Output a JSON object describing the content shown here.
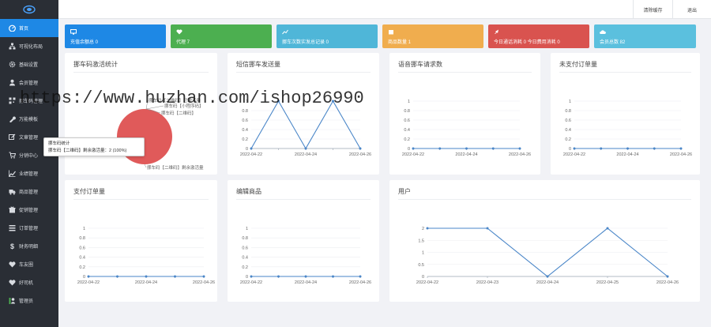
{
  "sidebar": {
    "items": [
      {
        "label": "首页",
        "icon": "dashboard-icon",
        "active": true
      },
      {
        "label": "可视化布局",
        "icon": "sitemap-icon"
      },
      {
        "label": "基础设置",
        "icon": "gear-icon"
      },
      {
        "label": "会员管理",
        "icon": "user-icon"
      },
      {
        "label": "挪车码管理",
        "icon": "qrcode-icon"
      },
      {
        "label": "万能模板",
        "icon": "wrench-icon"
      },
      {
        "label": "文章管理",
        "icon": "edit-icon"
      },
      {
        "label": "分销中心",
        "icon": "cart-icon"
      },
      {
        "label": "业绩管理",
        "icon": "chart-icon"
      },
      {
        "label": "商品管理",
        "icon": "truck-icon"
      },
      {
        "label": "促销管理",
        "icon": "gift-icon"
      },
      {
        "label": "订单管理",
        "icon": "list-icon"
      },
      {
        "label": "财务明细",
        "icon": "dollar-icon"
      },
      {
        "label": "车友圈",
        "icon": "heart-icon"
      },
      {
        "label": "好司机",
        "icon": "heart-icon"
      },
      {
        "label": "管理员",
        "icon": "admin-icon"
      }
    ]
  },
  "topbar": {
    "clear_cache": "清除缓存",
    "logout": "退出"
  },
  "stats": [
    {
      "label": "充值余额总 0",
      "color": "#1e88e5",
      "icon": "monitor-icon"
    },
    {
      "label": "代理 7",
      "color": "#4caf50",
      "icon": "heart-icon"
    },
    {
      "label": "挪车次数实发总记录 0",
      "color": "#4fb6d8",
      "icon": "line-chart-icon"
    },
    {
      "label": "商品数量 1",
      "color": "#f0ad4e",
      "icon": "cube-icon"
    },
    {
      "label": "今日通话消耗 0 今日费用消耗 0",
      "color": "#d9534f",
      "icon": "rocket-icon"
    },
    {
      "label": "会员总数 82",
      "color": "#5bc0de",
      "icon": "cloud-icon"
    }
  ],
  "cards": {
    "activation": {
      "title": "挪车码激活统计"
    },
    "sms": {
      "title": "短信挪车发送量"
    },
    "voice": {
      "title": "语音挪车请求数"
    },
    "unpaid": {
      "title": "未支付订单量"
    },
    "paid": {
      "title": "支付订单量"
    },
    "edit_goods": {
      "title": "编辑商品"
    },
    "users": {
      "title": "用户"
    }
  },
  "tooltip": {
    "line1": "挪车码统计",
    "line2": "挪车码【二维码】剩余激活量：2 (100%)"
  },
  "watermark": "https://www.huzhan.com/ishop26990",
  "chart_data": [
    {
      "type": "pie",
      "title": "挪车码激活统计",
      "labels": [
        "挪车码【二维码】已激活量",
        "挪车码【小程序码】",
        "挪车码【二维码】",
        "挪车码【二维码】剩余激活量"
      ],
      "values": [
        0,
        0,
        0,
        2
      ],
      "colors": [
        "#e05a5a"
      ]
    },
    {
      "type": "line",
      "title": "短信挪车发送量",
      "x": [
        "2022-04-22",
        "2022-04-23",
        "2022-04-24",
        "2022-04-25",
        "2022-04-26"
      ],
      "y": [
        0,
        1,
        0,
        1,
        0
      ],
      "yticks": [
        "0",
        "0.2",
        "0.4",
        "0.6",
        "0.8",
        "1"
      ],
      "xticks": [
        "2022-04-22",
        "2022-04-24",
        "2022-04-26"
      ],
      "ylim": [
        0,
        1
      ]
    },
    {
      "type": "line",
      "title": "语音挪车请求数",
      "x": [
        "2022-04-22",
        "2022-04-23",
        "2022-04-24",
        "2022-04-25",
        "2022-04-26"
      ],
      "y": [
        0,
        0,
        0,
        0,
        0
      ],
      "yticks": [
        "0",
        "0.2",
        "0.4",
        "0.6",
        "0.8",
        "1"
      ],
      "xticks": [
        "2022-04-22",
        "2022-04-24",
        "2022-04-26"
      ],
      "ylim": [
        0,
        1
      ]
    },
    {
      "type": "line",
      "title": "未支付订单量",
      "x": [
        "2022-04-22",
        "2022-04-23",
        "2022-04-24",
        "2022-04-25",
        "2022-04-26"
      ],
      "y": [
        0,
        0,
        0,
        0,
        0
      ],
      "yticks": [
        "0",
        "0.2",
        "0.4",
        "0.6",
        "0.8",
        "1"
      ],
      "xticks": [
        "2022-04-22",
        "2022-04-24",
        "2022-04-26"
      ],
      "ylim": [
        0,
        1
      ]
    },
    {
      "type": "line",
      "title": "支付订单量",
      "x": [
        "2022-04-22",
        "2022-04-23",
        "2022-04-24",
        "2022-04-25",
        "2022-04-26"
      ],
      "y": [
        0,
        0,
        0,
        0,
        0
      ],
      "yticks": [
        "0",
        "0.2",
        "0.4",
        "0.6",
        "0.8",
        "1"
      ],
      "xticks": [
        "2022-04-22",
        "2022-04-24",
        "2022-04-26"
      ],
      "ylim": [
        0,
        1
      ]
    },
    {
      "type": "line",
      "title": "编辑商品",
      "x": [
        "2022-04-22",
        "2022-04-23",
        "2022-04-24",
        "2022-04-25",
        "2022-04-26"
      ],
      "y": [
        0,
        0,
        0,
        0,
        0
      ],
      "yticks": [
        "0",
        "0.2",
        "0.4",
        "0.6",
        "0.8",
        "1"
      ],
      "xticks": [
        "2022-04-22",
        "2022-04-24",
        "2022-04-26"
      ],
      "ylim": [
        0,
        1
      ]
    },
    {
      "type": "line",
      "title": "用户",
      "x": [
        "2022-04-22",
        "2022-04-23",
        "2022-04-24",
        "2022-04-25",
        "2022-04-26"
      ],
      "y": [
        2,
        2,
        0,
        2,
        0
      ],
      "yticks": [
        "0",
        "0.5",
        "1",
        "1.5",
        "2"
      ],
      "xticks": [
        "2022-04-22",
        "2022-04-23",
        "2022-04-24",
        "2022-04-25",
        "2022-04-26"
      ],
      "ylim": [
        0,
        2
      ]
    }
  ]
}
